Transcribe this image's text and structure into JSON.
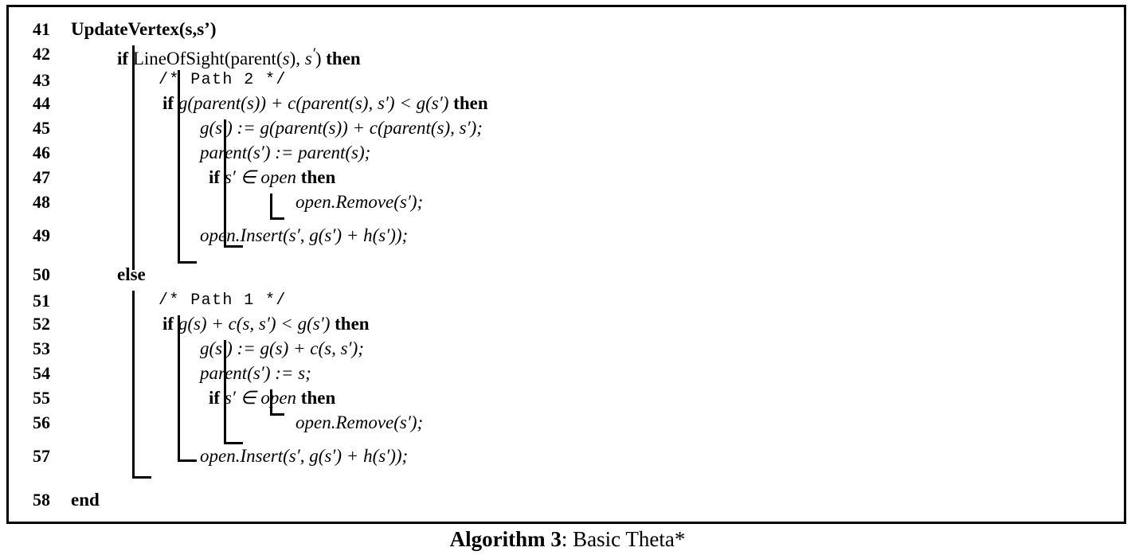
{
  "document": {
    "type": "algorithm-pseudocode",
    "caption_label": "Algorithm 3",
    "caption_separator": ": ",
    "caption_title": "Basic Theta*"
  },
  "lines": [
    {
      "n": "41",
      "indent": 0
    },
    {
      "n": "42",
      "indent": 1
    },
    {
      "n": "43",
      "indent": 2
    },
    {
      "n": "44",
      "indent": 2
    },
    {
      "n": "45",
      "indent": 3
    },
    {
      "n": "46",
      "indent": 3
    },
    {
      "n": "47",
      "indent": 3
    },
    {
      "n": "48",
      "indent": 4
    },
    {
      "n": "49",
      "indent": 3
    },
    {
      "n": "50",
      "indent": 1
    },
    {
      "n": "51",
      "indent": 2
    },
    {
      "n": "52",
      "indent": 2
    },
    {
      "n": "53",
      "indent": 3
    },
    {
      "n": "54",
      "indent": 3
    },
    {
      "n": "55",
      "indent": 3
    },
    {
      "n": "56",
      "indent": 4
    },
    {
      "n": "57",
      "indent": 3
    },
    {
      "n": "58",
      "indent": 0
    }
  ],
  "code": {
    "l41": {
      "num": "41",
      "text": "UpdateVertex(s,s’)"
    },
    "l42": {
      "num": "42",
      "kw_if": "if",
      "call": "LineOfSight",
      "arg_open": "(",
      "fn": "parent",
      "var_s": "s",
      "mid": "),",
      "var_sp": "s",
      "prime": "′",
      "close": ")",
      "kw_then": "then"
    },
    "l43": {
      "num": "43",
      "comment": "/* Path 2 */"
    },
    "l44": {
      "num": "44",
      "kw_if": "if",
      "expr": "g(parent(s)) + c(parent(s), s′) < g(s′)",
      "kw_then": "then"
    },
    "l45": {
      "num": "45",
      "stmt": "g(s′) := g(parent(s)) + c(parent(s), s′);"
    },
    "l46": {
      "num": "46",
      "stmt": "parent(s′) := parent(s);"
    },
    "l47": {
      "num": "47",
      "kw_if": "if",
      "expr": "s′ ∈ open",
      "kw_then": "then"
    },
    "l48": {
      "num": "48",
      "stmt": "open.Remove(s′);"
    },
    "l49": {
      "num": "49",
      "stmt": "open.Insert(s′, g(s′) + h(s′));"
    },
    "l50": {
      "num": "50",
      "kw_else": "else"
    },
    "l51": {
      "num": "51",
      "comment": "/* Path 1 */"
    },
    "l52": {
      "num": "52",
      "kw_if": "if",
      "expr": "g(s) + c(s, s′) < g(s′)",
      "kw_then": "then"
    },
    "l53": {
      "num": "53",
      "stmt": "g(s′) := g(s) + c(s, s′);"
    },
    "l54": {
      "num": "54",
      "stmt": "parent(s′) := s;"
    },
    "l55": {
      "num": "55",
      "kw_if": "if",
      "expr": "s′ ∈ open",
      "kw_then": "then"
    },
    "l56": {
      "num": "56",
      "stmt": "open.Remove(s′);"
    },
    "l57": {
      "num": "57",
      "stmt": "open.Insert(s′, g(s′) + h(s′));"
    },
    "l58": {
      "num": "58",
      "kw_end": "end"
    }
  },
  "tokens": {
    "if": "if",
    "then": "then",
    "else": "else",
    "end": "end",
    "open": "open",
    "parent": "parent",
    "lineofsight": "LineOfSight",
    "remove": "open.Remove",
    "insert": "open.Insert",
    "assign": ":=",
    "plus": "+",
    "less": "<",
    "in": "∈",
    "prime": "′",
    "g": "g",
    "c": "c",
    "h": "h",
    "s": "s",
    "semicolon": ";",
    "comma": ",",
    "lparen": "(",
    "rparen": ")"
  },
  "colors": {
    "ink": "#000000",
    "page": "#ffffff"
  }
}
